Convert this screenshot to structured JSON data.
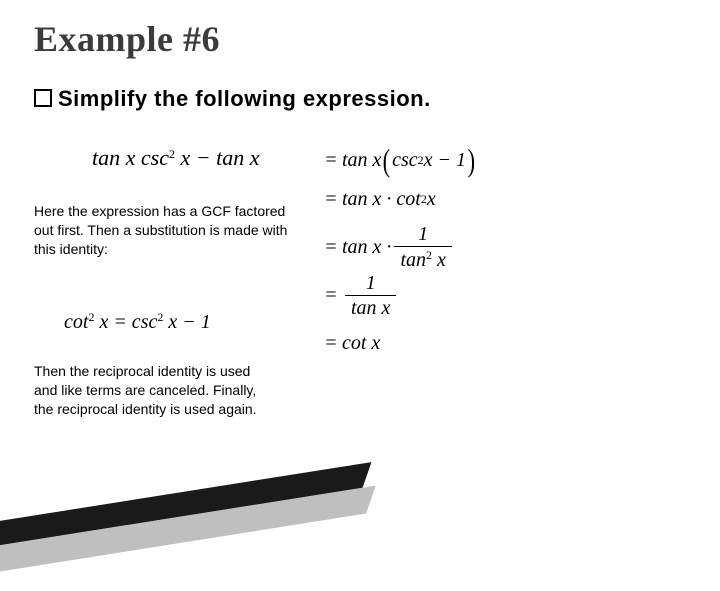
{
  "title": "Example #6",
  "prompt": "Simplify the following expression.",
  "math": {
    "main": "tan x csc² x − tan x",
    "step1_pre": "= tan x",
    "step1_inner": "csc² x − 1",
    "step2": "= tan x · cot² x",
    "step3_pre": "= tan x ·",
    "step3_num": "1",
    "step3_den": "tan² x",
    "step4_num": "1",
    "step4_den": "tan x",
    "step5": "= cot x",
    "identity": "cot² x = csc² x − 1"
  },
  "notes": {
    "a": "Here the expression has a GCF factored out first.  Then a substitution is made with this identity:",
    "b": "Then the reciprocal identity is used and like terms are canceled.  Finally, the reciprocal identity is used again."
  }
}
